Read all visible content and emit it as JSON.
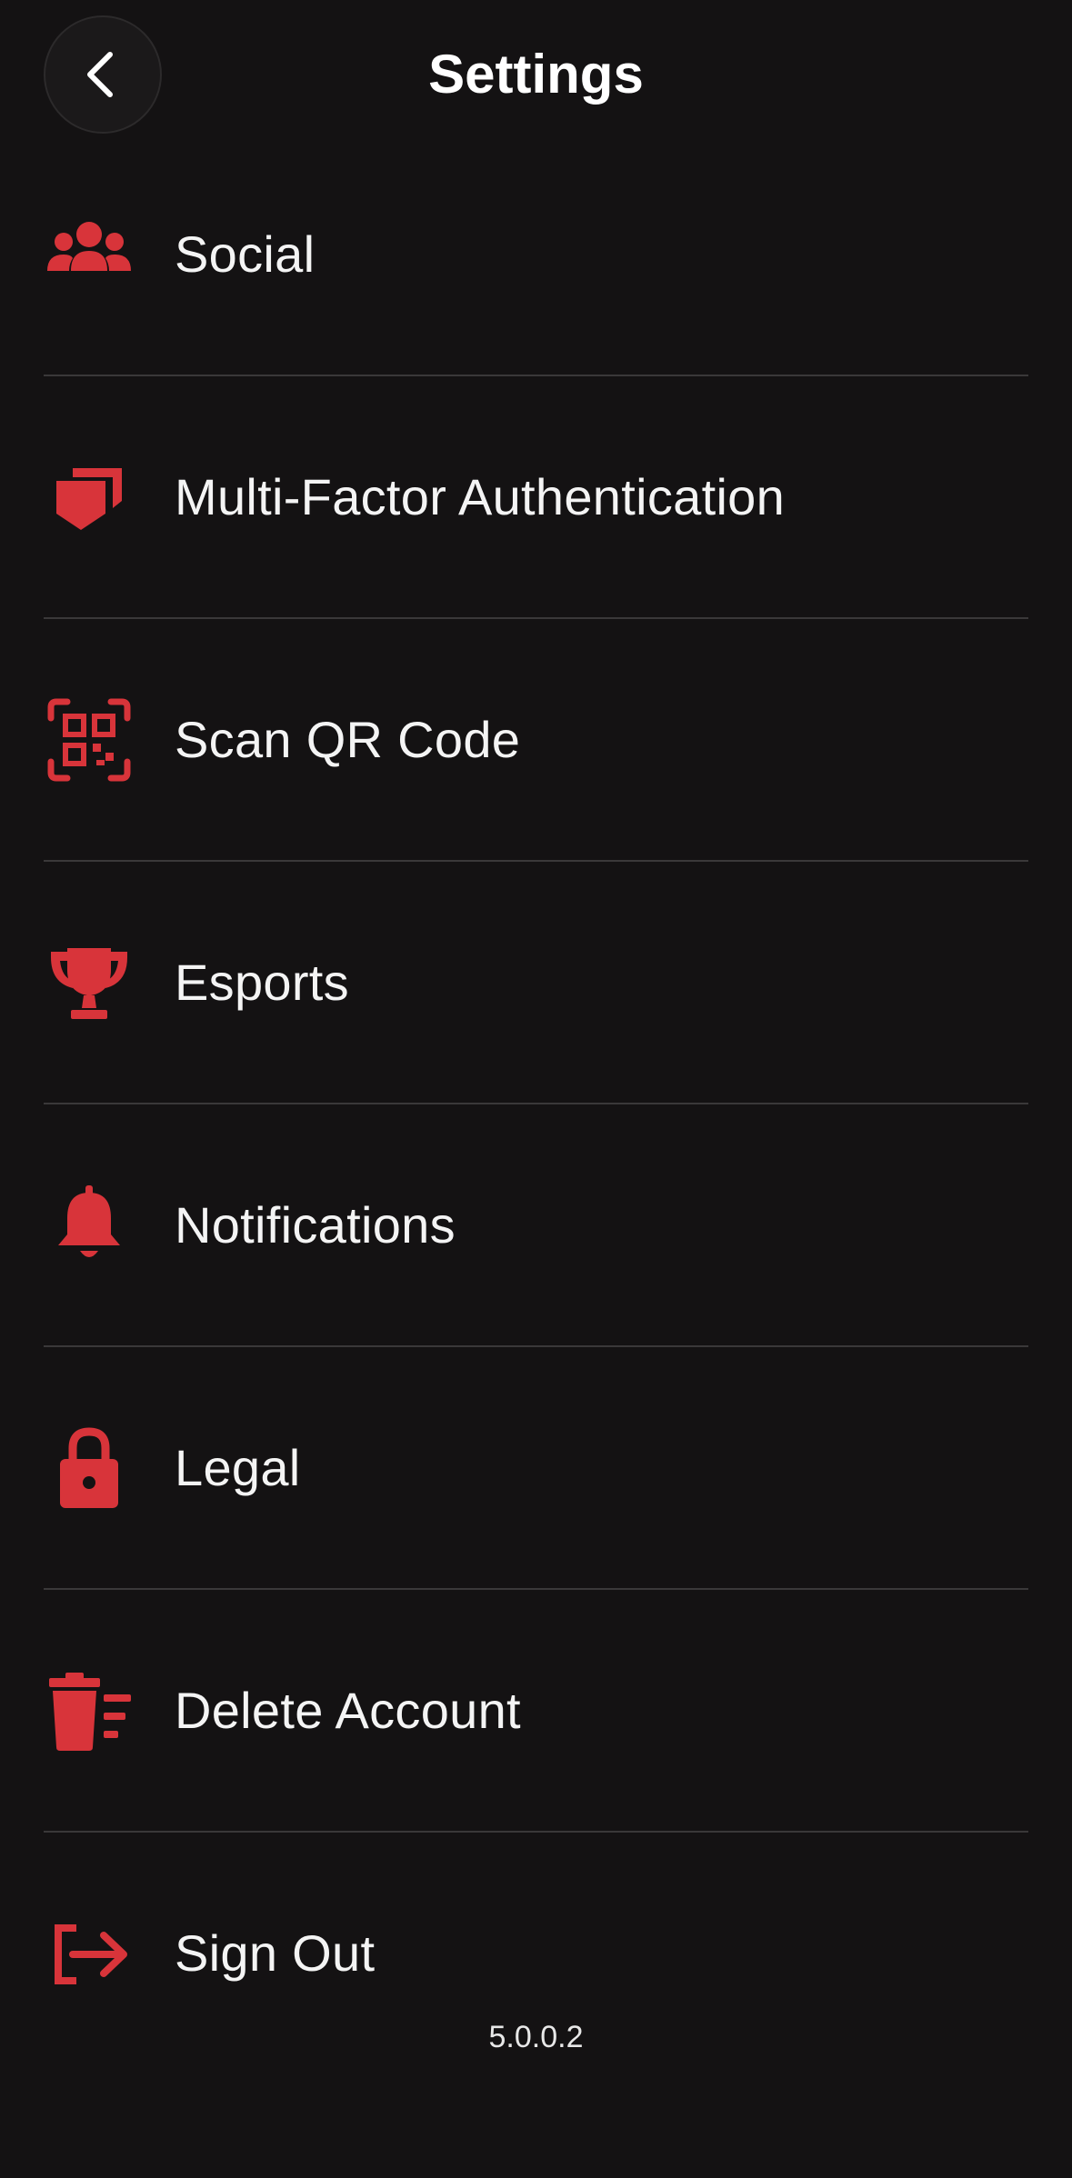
{
  "header": {
    "title": "Settings",
    "back_icon": "chevron-left-icon"
  },
  "menu": {
    "items": [
      {
        "label": "Social",
        "icon": "users-icon"
      },
      {
        "label": "Multi-Factor Authentication",
        "icon": "shield-icon"
      },
      {
        "label": "Scan QR Code",
        "icon": "qr-code-icon"
      },
      {
        "label": "Esports",
        "icon": "trophy-icon"
      },
      {
        "label": "Notifications",
        "icon": "bell-icon"
      },
      {
        "label": "Legal",
        "icon": "lock-icon"
      },
      {
        "label": "Delete Account",
        "icon": "trash-icon"
      },
      {
        "label": "Sign Out",
        "icon": "sign-out-icon"
      }
    ]
  },
  "footer": {
    "version": "5.0.0.2"
  },
  "colors": {
    "background": "#141213",
    "accent": "#d8343a",
    "text": "#f4f4f4",
    "divider": "#3a3839"
  }
}
